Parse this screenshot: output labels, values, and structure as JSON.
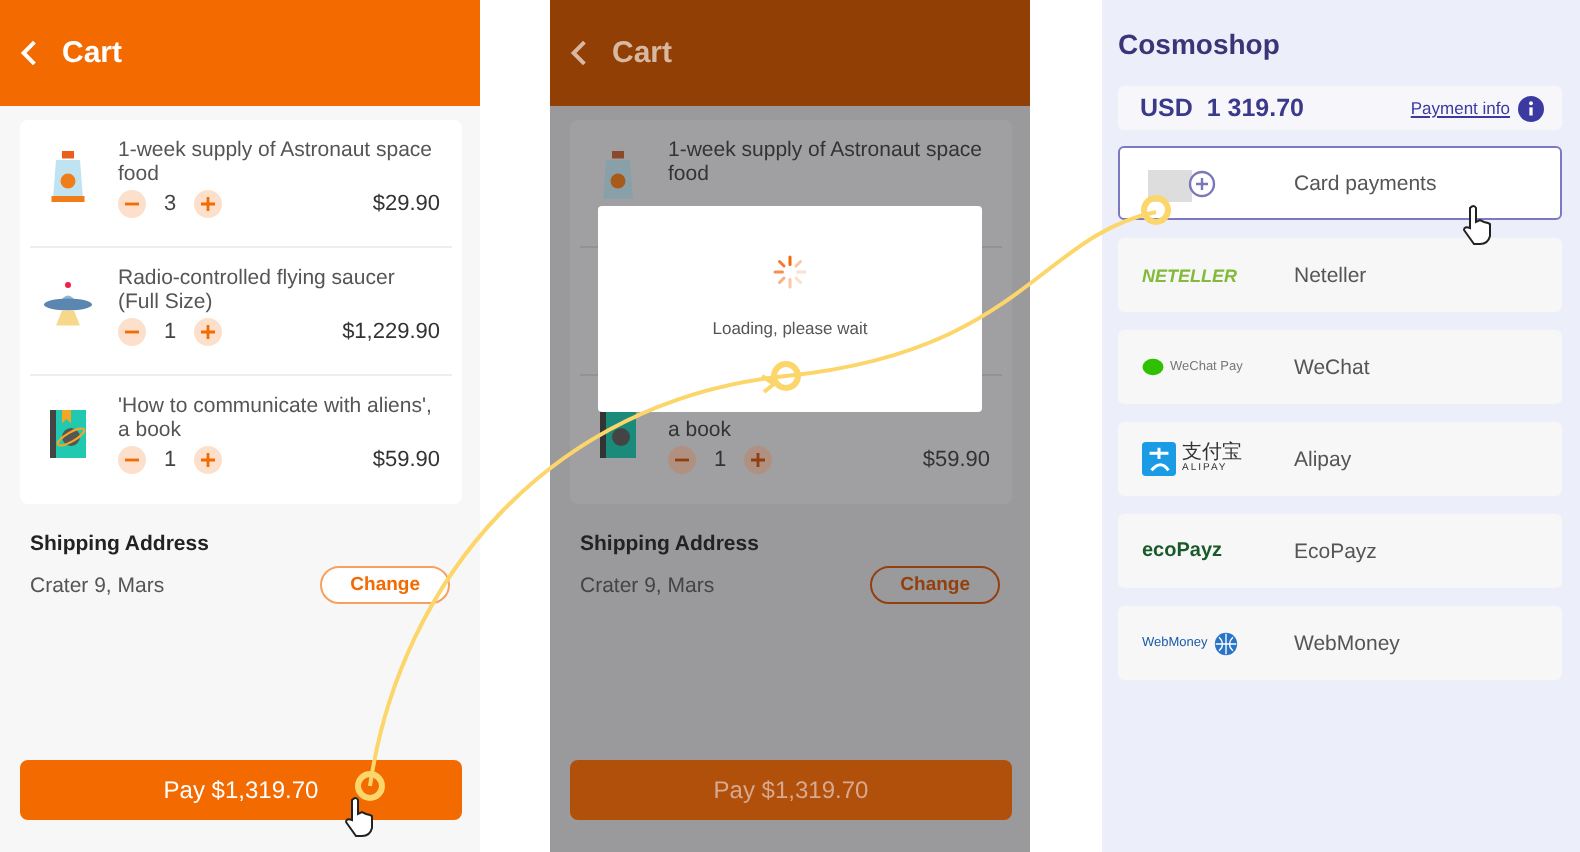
{
  "cart_screen": {
    "title": "Cart",
    "items": [
      {
        "kind": "food",
        "title": "1-week supply of Astronaut space food",
        "quantity": "3",
        "price": "$29.90"
      },
      {
        "kind": "saucer",
        "title": "Radio-controlled flying saucer (Full Size)",
        "quantity": "1",
        "price": "$1,229.90"
      },
      {
        "kind": "book",
        "title": "'How to communicate with aliens', a book",
        "quantity": "1",
        "price": "$59.90"
      }
    ],
    "shipping": {
      "label": "Shipping Address",
      "address": "Crater 9, Mars",
      "change_button": "Change"
    },
    "pay_button": "Pay $1,319.70"
  },
  "loading_screen": {
    "title": "Cart",
    "first_item": {
      "kind": "food",
      "title": "1-week supply of Astronaut space food"
    },
    "last_item": {
      "kind": "book",
      "title_end": "a book",
      "quantity": "1",
      "price": "$59.90"
    },
    "dialog": {
      "message": "Loading, please wait"
    },
    "shipping": {
      "label": "Shipping Address",
      "address": "Crater 9, Mars",
      "change_button": "Change"
    },
    "pay_button": "Pay $1,319.70"
  },
  "payment_screen": {
    "shop_name": "Cosmoshop",
    "amount": "USD  1 319.70",
    "payment_info_link": "Payment info",
    "methods": [
      {
        "kind": "card",
        "name": "Card payments",
        "selected": true
      },
      {
        "kind": "neteller",
        "logo_text": "NETELLER",
        "name": "Neteller",
        "selected": false
      },
      {
        "kind": "wechat",
        "logo_text": "WeChat Pay",
        "name": "WeChat",
        "selected": false
      },
      {
        "kind": "alipay",
        "logo_text": "支付宝",
        "logo_subtext": "ALIPAY",
        "name": "Alipay",
        "selected": false
      },
      {
        "kind": "ecopayz",
        "logo_text": "ecoPayz",
        "name": "EcoPayz",
        "selected": false
      },
      {
        "kind": "webmoney",
        "logo_text": "WebMoney",
        "name": "WebMoney",
        "selected": false
      }
    ]
  }
}
